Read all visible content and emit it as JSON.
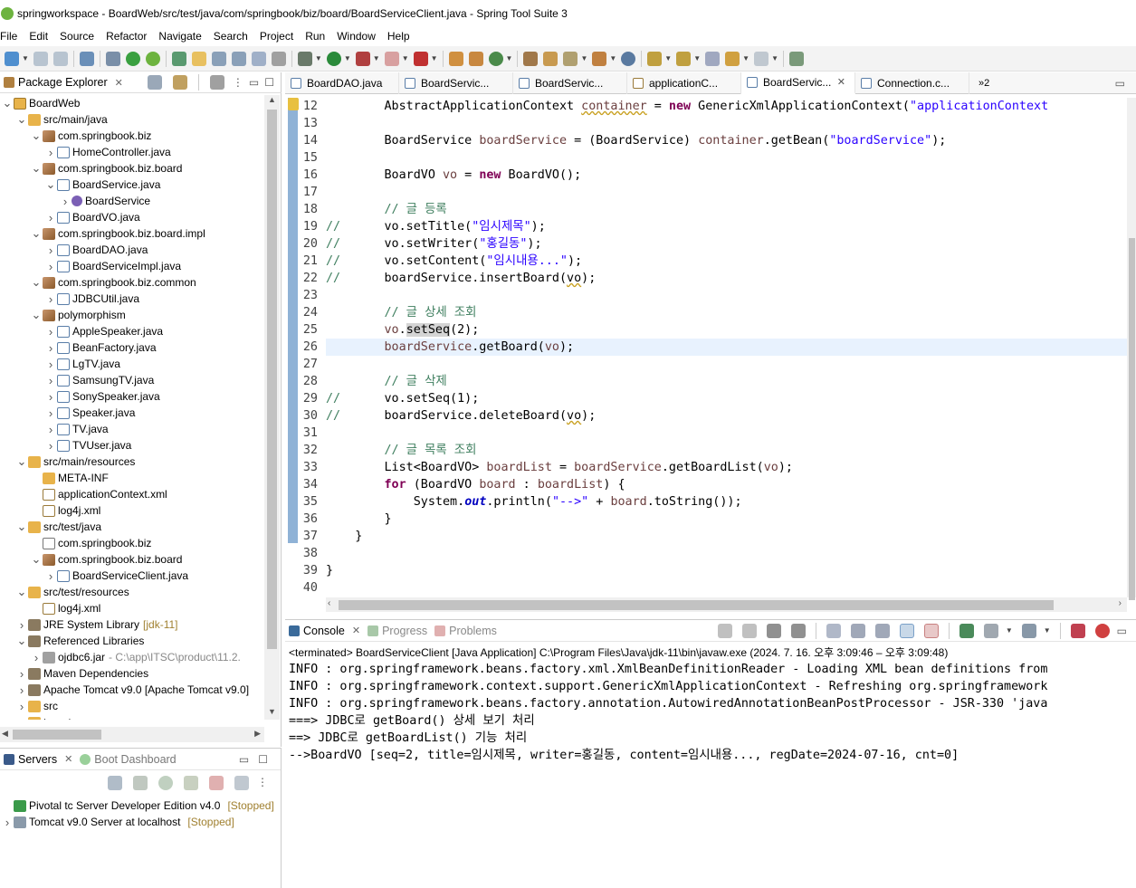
{
  "window": {
    "title": "springworkspace - BoardWeb/src/test/java/com/springbook/biz/board/BoardServiceClient.java - Spring Tool Suite 3"
  },
  "menu": [
    "File",
    "Edit",
    "Source",
    "Refactor",
    "Navigate",
    "Search",
    "Project",
    "Run",
    "Window",
    "Help"
  ],
  "package_explorer": {
    "title": "Package Explorer",
    "tree": [
      {
        "d": 0,
        "a": "v",
        "i": "proj",
        "t": "BoardWeb"
      },
      {
        "d": 1,
        "a": "v",
        "i": "folder",
        "t": "src/main/java"
      },
      {
        "d": 2,
        "a": "v",
        "i": "pkg",
        "t": "com.springbook.biz"
      },
      {
        "d": 3,
        "a": ">",
        "i": "java",
        "t": "HomeController.java"
      },
      {
        "d": 2,
        "a": "v",
        "i": "pkg",
        "t": "com.springbook.biz.board"
      },
      {
        "d": 3,
        "a": "v",
        "i": "java",
        "t": "BoardService.java"
      },
      {
        "d": 4,
        "a": ">",
        "i": "iface",
        "t": "BoardService"
      },
      {
        "d": 3,
        "a": ">",
        "i": "java",
        "t": "BoardVO.java"
      },
      {
        "d": 2,
        "a": "v",
        "i": "pkg",
        "t": "com.springbook.biz.board.impl"
      },
      {
        "d": 3,
        "a": ">",
        "i": "java",
        "t": "BoardDAO.java"
      },
      {
        "d": 3,
        "a": ">",
        "i": "java",
        "t": "BoardServiceImpl.java"
      },
      {
        "d": 2,
        "a": "v",
        "i": "pkg",
        "t": "com.springbook.biz.common"
      },
      {
        "d": 3,
        "a": ">",
        "i": "java",
        "t": "JDBCUtil.java"
      },
      {
        "d": 2,
        "a": "v",
        "i": "pkg",
        "t": "polymorphism"
      },
      {
        "d": 3,
        "a": ">",
        "i": "java",
        "t": "AppleSpeaker.java"
      },
      {
        "d": 3,
        "a": ">",
        "i": "java",
        "t": "BeanFactory.java"
      },
      {
        "d": 3,
        "a": ">",
        "i": "java",
        "t": "LgTV.java"
      },
      {
        "d": 3,
        "a": ">",
        "i": "java",
        "t": "SamsungTV.java"
      },
      {
        "d": 3,
        "a": ">",
        "i": "java",
        "t": "SonySpeaker.java"
      },
      {
        "d": 3,
        "a": ">",
        "i": "java",
        "t": "Speaker.java"
      },
      {
        "d": 3,
        "a": ">",
        "i": "java",
        "t": "TV.java"
      },
      {
        "d": 3,
        "a": ">",
        "i": "java",
        "t": "TVUser.java"
      },
      {
        "d": 1,
        "a": "v",
        "i": "folder",
        "t": "src/main/resources"
      },
      {
        "d": 2,
        "a": "",
        "i": "folder",
        "t": "META-INF"
      },
      {
        "d": 2,
        "a": "",
        "i": "xml",
        "t": "applicationContext.xml"
      },
      {
        "d": 2,
        "a": "",
        "i": "xml",
        "t": "log4j.xml"
      },
      {
        "d": 1,
        "a": "v",
        "i": "folder",
        "t": "src/test/java"
      },
      {
        "d": 2,
        "a": "",
        "i": "emptypkg",
        "t": "com.springbook.biz"
      },
      {
        "d": 2,
        "a": "v",
        "i": "pkg",
        "t": "com.springbook.biz.board"
      },
      {
        "d": 3,
        "a": ">",
        "i": "java",
        "t": "BoardServiceClient.java"
      },
      {
        "d": 1,
        "a": "v",
        "i": "folder",
        "t": "src/test/resources"
      },
      {
        "d": 2,
        "a": "",
        "i": "xml",
        "t": "log4j.xml"
      },
      {
        "d": 1,
        "a": ">",
        "i": "lib",
        "t": "JRE System Library",
        "x": "[jdk-11]"
      },
      {
        "d": 1,
        "a": "v",
        "i": "lib",
        "t": "Referenced Libraries"
      },
      {
        "d": 2,
        "a": ">",
        "i": "jar",
        "t": "ojdbc6.jar",
        "x": "- C:\\app\\ITSC\\product\\11.2."
      },
      {
        "d": 1,
        "a": ">",
        "i": "lib",
        "t": "Maven Dependencies"
      },
      {
        "d": 1,
        "a": ">",
        "i": "lib",
        "t": "Apache Tomcat v9.0 [Apache Tomcat v9.0]"
      },
      {
        "d": 1,
        "a": ">",
        "i": "folder",
        "t": "src"
      },
      {
        "d": 1,
        "a": ">",
        "i": "folder",
        "t": "target"
      }
    ]
  },
  "servers": {
    "tab1": "Servers",
    "tab2": "Boot Dashboard",
    "items": [
      {
        "name": "Pivotal tc Server Developer Edition v4.0",
        "status": "[Stopped]"
      },
      {
        "name": "Tomcat v9.0 Server at localhost",
        "status": "[Stopped]"
      }
    ]
  },
  "editor": {
    "tabs": [
      "BoardDAO.java",
      "BoardServic...",
      "BoardServic...",
      "applicationC...",
      "BoardServic...",
      "Connection.c..."
    ],
    "active_tab": 4,
    "overflow": "»2",
    "line_numbers": [
      "12",
      "13",
      "14",
      "15",
      "16",
      "17",
      "18",
      "19",
      "20",
      "21",
      "22",
      "23",
      "24",
      "25",
      "26",
      "27",
      "28",
      "29",
      "30",
      "31",
      "32",
      "33",
      "34",
      "35",
      "36",
      "37",
      "38",
      "39",
      "40"
    ]
  },
  "console": {
    "tabs": [
      "Console",
      "Progress",
      "Problems"
    ],
    "terminated": "<terminated> BoardServiceClient [Java Application] C:\\Program Files\\Java\\jdk-11\\bin\\javaw.exe  (2024. 7. 16. 오후 3:09:46 – 오후 3:09:48)",
    "lines": [
      "INFO : org.springframework.beans.factory.xml.XmlBeanDefinitionReader - Loading XML bean definitions from",
      "INFO : org.springframework.context.support.GenericXmlApplicationContext - Refreshing org.springframework",
      "INFO : org.springframework.beans.factory.annotation.AutowiredAnnotationBeanPostProcessor - JSR-330 'java",
      "===> JDBC로 getBoard() 상세 보기 처리",
      "==> JDBC로 getBoardList() 기능 처리",
      "-->BoardVO [seq=2, title=임시제목, writer=홍길동, content=임시내용..., regDate=2024-07-16, cnt=0]"
    ]
  }
}
